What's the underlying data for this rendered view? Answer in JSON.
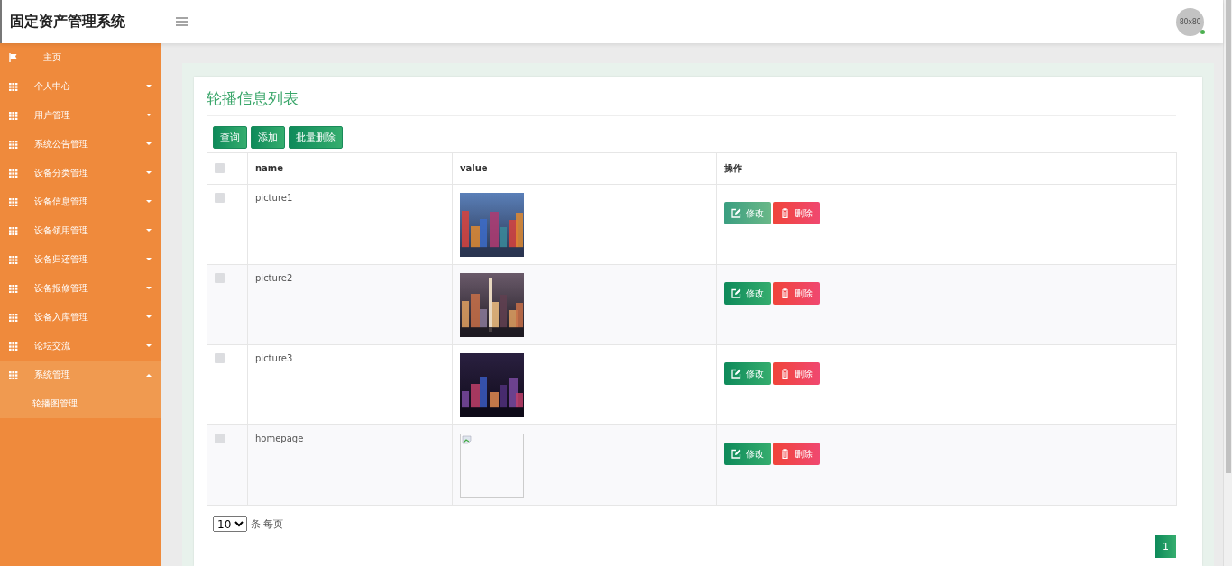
{
  "header": {
    "title": "固定资产管理系统",
    "avatar_text": "80x80",
    "online": true
  },
  "sidebar": {
    "items": [
      {
        "kind": "home",
        "label": "主页",
        "expanded": false
      },
      {
        "kind": "group",
        "label": "个人中心",
        "expanded": false
      },
      {
        "kind": "group",
        "label": "用户管理",
        "expanded": false
      },
      {
        "kind": "group",
        "label": "系统公告管理",
        "expanded": false
      },
      {
        "kind": "group",
        "label": "设备分类管理",
        "expanded": false
      },
      {
        "kind": "group",
        "label": "设备信息管理",
        "expanded": false
      },
      {
        "kind": "group",
        "label": "设备领用管理",
        "expanded": false
      },
      {
        "kind": "group",
        "label": "设备归还管理",
        "expanded": false
      },
      {
        "kind": "group",
        "label": "设备报修管理",
        "expanded": false
      },
      {
        "kind": "group",
        "label": "设备入库管理",
        "expanded": false
      },
      {
        "kind": "group",
        "label": "论坛交流",
        "expanded": false
      },
      {
        "kind": "group",
        "label": "系统管理",
        "expanded": true,
        "children": [
          {
            "label": "轮播图管理"
          }
        ]
      }
    ]
  },
  "page": {
    "title": "轮播信息列表",
    "toolbar": [
      "查询",
      "添加",
      "批量删除"
    ],
    "table": {
      "all_checked": false,
      "columns": [
        "name",
        "value",
        "操作"
      ],
      "rows": [
        {
          "checked": false,
          "name": "picture1",
          "edit": {
            "label": "修改",
            "hovered": true
          },
          "delete": "删除"
        },
        {
          "checked": false,
          "name": "picture2",
          "edit": {
            "label": "修改",
            "hovered": false
          },
          "delete": "删除"
        },
        {
          "checked": false,
          "name": "picture3",
          "edit": {
            "label": "修改",
            "hovered": false
          },
          "delete": "删除"
        },
        {
          "checked": false,
          "name": "homepage",
          "value": {
            "kind": "broken-image"
          },
          "edit": {
            "label": "修改",
            "hovered": false
          },
          "delete": "删除"
        }
      ]
    },
    "page_size": "10",
    "page_size_label": "条 每页",
    "pages": [
      {
        "label": "1",
        "selected": true
      }
    ]
  }
}
